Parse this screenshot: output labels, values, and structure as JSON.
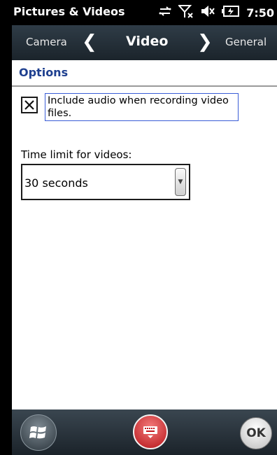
{
  "status_bar": {
    "app_title": "Pictures & Videos",
    "time": "7:50",
    "icons": [
      "sync-icon",
      "no-signal-icon",
      "volume-muted-icon",
      "battery-icon"
    ]
  },
  "tabs": {
    "previous": "Camera",
    "current": "Video",
    "next": "General"
  },
  "section": {
    "title": "Options"
  },
  "options": {
    "audio_checkbox": {
      "checked": true,
      "label": "Include audio when recording video files."
    },
    "time_limit": {
      "label": "Time limit for videos:",
      "value": "30 seconds"
    }
  },
  "bottom_bar": {
    "ok_label": "OK"
  },
  "colors": {
    "section_title": "#1e3f8f",
    "focus_border": "#3a5dd6",
    "header_bg": "#2f3c47",
    "keyboard_button": "#d32a2e"
  }
}
